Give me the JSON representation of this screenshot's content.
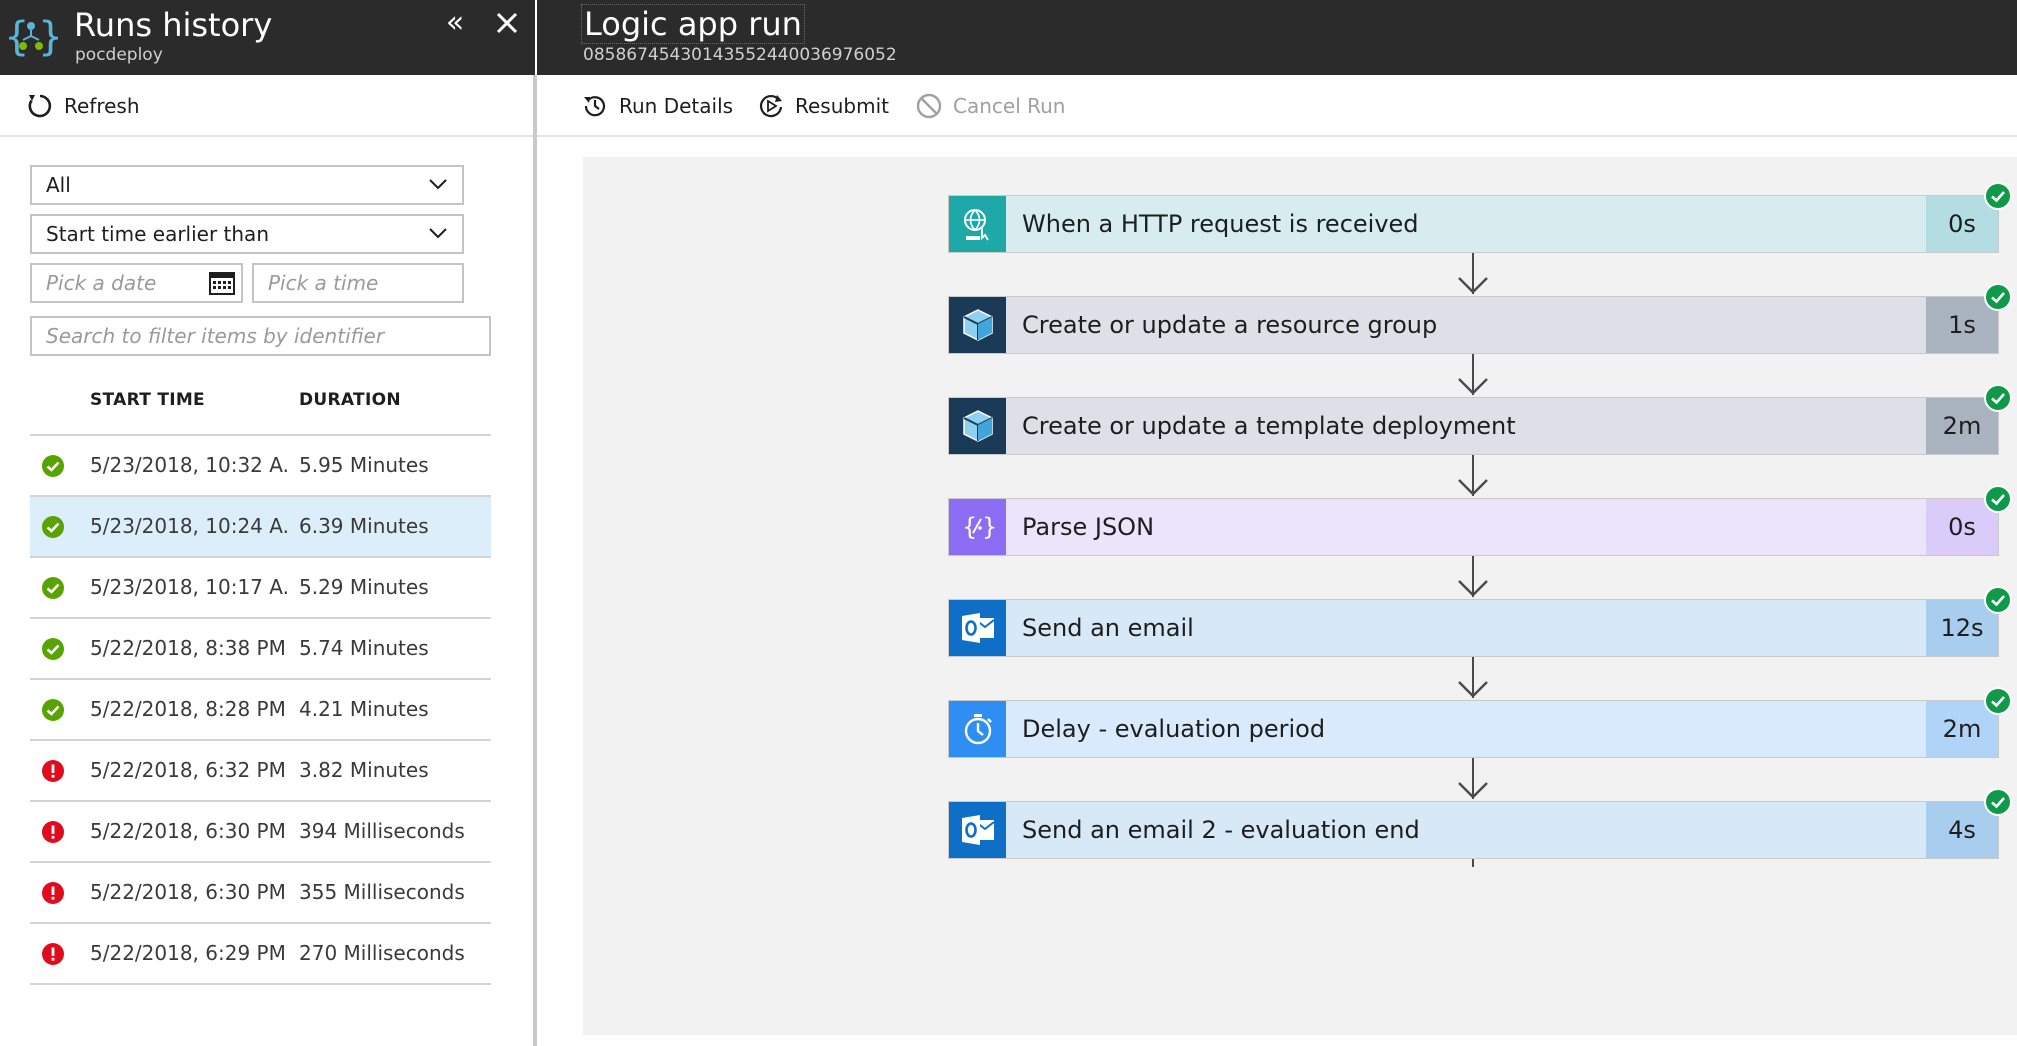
{
  "left_blade": {
    "title": "Runs history",
    "subtitle": "pocdeploy",
    "collapse_glyph": "«",
    "refresh_label": "Refresh",
    "filters": {
      "status_value": "All",
      "time_filter_value": "Start time earlier than",
      "date_placeholder": "Pick a date",
      "time_placeholder": "Pick a time",
      "search_placeholder": "Search to filter items by identifier"
    },
    "columns": {
      "start_time": "START TIME",
      "duration": "DURATION"
    },
    "runs": [
      {
        "status": "succeeded",
        "start": "5/23/2018, 10:32 A...",
        "duration": "5.95 Minutes",
        "selected": false
      },
      {
        "status": "succeeded",
        "start": "5/23/2018, 10:24 A...",
        "duration": "6.39 Minutes",
        "selected": true
      },
      {
        "status": "succeeded",
        "start": "5/23/2018, 10:17 A...",
        "duration": "5.29 Minutes",
        "selected": false
      },
      {
        "status": "succeeded",
        "start": "5/22/2018, 8:38 PM",
        "duration": "5.74 Minutes",
        "selected": false
      },
      {
        "status": "succeeded",
        "start": "5/22/2018, 8:28 PM",
        "duration": "4.21 Minutes",
        "selected": false
      },
      {
        "status": "failed",
        "start": "5/22/2018, 6:32 PM",
        "duration": "3.82 Minutes",
        "selected": false
      },
      {
        "status": "failed",
        "start": "5/22/2018, 6:30 PM",
        "duration": "394 Milliseconds",
        "selected": false
      },
      {
        "status": "failed",
        "start": "5/22/2018, 6:30 PM",
        "duration": "355 Milliseconds",
        "selected": false
      },
      {
        "status": "failed",
        "start": "5/22/2018, 6:29 PM",
        "duration": "270 Milliseconds",
        "selected": false
      }
    ]
  },
  "right_blade": {
    "title": "Logic app run",
    "run_id": "08586745430143552440036976052",
    "toolbar": {
      "run_details_label": "Run Details",
      "resubmit_label": "Resubmit",
      "cancel_run_label": "Cancel Run"
    },
    "steps": [
      {
        "label": "When a HTTP request is received",
        "duration": "0s",
        "icon": "http-request-icon",
        "icon_bg": "#1fa8a8",
        "body_bg": "#d6ecef",
        "duration_bg": "#b3dde2",
        "status": "succeeded"
      },
      {
        "label": "Create or update a resource group",
        "duration": "1s",
        "icon": "azure-resource-manager-icon",
        "icon_bg": "#1b3a57",
        "body_bg": "#dde1e7",
        "duration_bg": "#a9b3c0",
        "status": "succeeded"
      },
      {
        "label": "Create or update a template deployment",
        "duration": "2m",
        "icon": "azure-resource-manager-icon",
        "icon_bg": "#1b3a57",
        "body_bg": "#dde1e7",
        "duration_bg": "#a9b3c0",
        "status": "succeeded"
      },
      {
        "label": "Parse JSON",
        "duration": "0s",
        "icon": "parse-json-icon",
        "icon_bg": "#8c6cf2",
        "body_bg": "#ebe5fc",
        "duration_bg": "#d9ccfa",
        "status": "succeeded"
      },
      {
        "label": "Send an email",
        "duration": "12s",
        "icon": "outlook-icon",
        "icon_bg": "#0f6ec6",
        "body_bg": "#d7e8f7",
        "duration_bg": "#a9cdee",
        "status": "succeeded"
      },
      {
        "label": "Delay - evaluation period",
        "duration": "2m",
        "icon": "timer-icon",
        "icon_bg": "#2e8ef2",
        "body_bg": "#d9eafc",
        "duration_bg": "#b0d3f8",
        "status": "succeeded"
      },
      {
        "label": "Send an email 2 - evaluation end",
        "duration": "4s",
        "icon": "outlook-icon",
        "icon_bg": "#0f6ec6",
        "body_bg": "#d7e8f7",
        "duration_bg": "#a9cdee",
        "status": "succeeded"
      }
    ]
  },
  "colors": {
    "header_bg": "#2b2b2b",
    "success": "#57a300",
    "error": "#e00b1c",
    "step_check": "#0e9a48",
    "selected_row": "#ddeefb",
    "canvas_bg": "#f2f2f2"
  }
}
